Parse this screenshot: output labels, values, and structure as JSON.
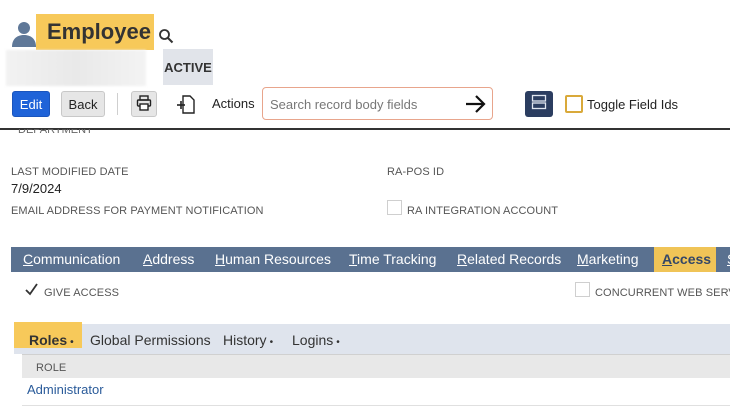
{
  "record": {
    "type": "Employee",
    "status": "ACTIVE"
  },
  "toolbar": {
    "edit_label": "Edit",
    "back_label": "Back",
    "actions_label": "Actions",
    "search_placeholder": "Search record body fields",
    "toggle_field_ids_label": "Toggle Field Ids"
  },
  "fields": {
    "cut_off_label": "DEPARTMENT",
    "last_modified_date_label": "LAST MODIFIED DATE",
    "last_modified_date_value": "7/9/2024",
    "ra_pos_id_label": "RA-POS ID",
    "email_payment_label": "EMAIL ADDRESS FOR PAYMENT NOTIFICATION",
    "ra_integration_label": "RA INTEGRATION ACCOUNT"
  },
  "tabs": [
    "Communication",
    "Address",
    "Human Resources",
    "Time Tracking",
    "Related Records",
    "Marketing",
    "Access",
    "S"
  ],
  "active_tab": "Access",
  "access": {
    "give_access_label": "GIVE ACCESS",
    "give_access_checked": true,
    "concurrent_label": "CONCURRENT WEB SERVIC",
    "concurrent_checked": false
  },
  "subtabs": [
    "Roles",
    "Global Permissions",
    "History",
    "Logins"
  ],
  "subtab_markers": [
    "•",
    "",
    "•",
    "•"
  ],
  "roles_table": {
    "column_header": "ROLE",
    "rows": [
      "Administrator"
    ]
  },
  "colors": {
    "highlight": "#f7c95a",
    "tab_bar": "#5a7190",
    "edit_button": "#1f63d8",
    "link": "#2a5b9a"
  },
  "icons": [
    "person-icon",
    "search-icon",
    "print-icon",
    "new-document-icon",
    "arrow-right-icon",
    "layout-icon",
    "checkmark-icon"
  ]
}
